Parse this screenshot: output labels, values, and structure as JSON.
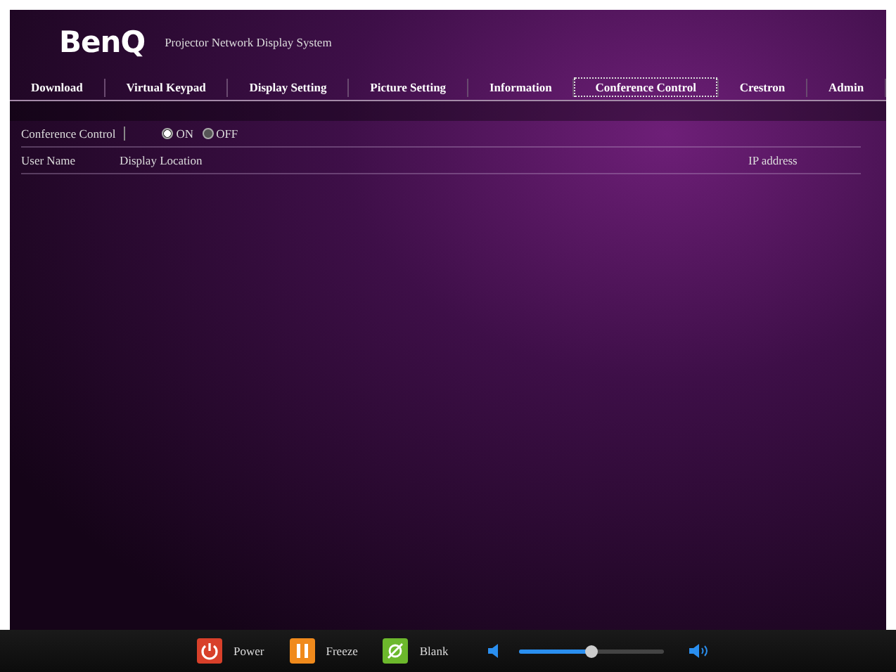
{
  "header": {
    "logo": "BenQ",
    "subtitle": "Projector Network Display System"
  },
  "tabs": [
    {
      "label": "Download",
      "selected": false
    },
    {
      "label": "Virtual Keypad",
      "selected": false
    },
    {
      "label": "Display Setting",
      "selected": false
    },
    {
      "label": "Picture Setting",
      "selected": false
    },
    {
      "label": "Information",
      "selected": false
    },
    {
      "label": "Conference Control",
      "selected": true
    },
    {
      "label": "Crestron",
      "selected": false
    },
    {
      "label": "Admin",
      "selected": false
    }
  ],
  "conference_control": {
    "label": "Conference Control",
    "options": [
      {
        "label": "ON",
        "selected": true
      },
      {
        "label": "OFF",
        "selected": false
      }
    ]
  },
  "table": {
    "columns": [
      "User Name",
      "Display Location",
      "IP address"
    ]
  },
  "control_bar": {
    "buttons": [
      {
        "kind": "power",
        "label": "Power"
      },
      {
        "kind": "freeze",
        "label": "Freeze"
      },
      {
        "kind": "blank",
        "label": "Blank"
      }
    ],
    "volume": {
      "level": 0.5
    }
  }
}
